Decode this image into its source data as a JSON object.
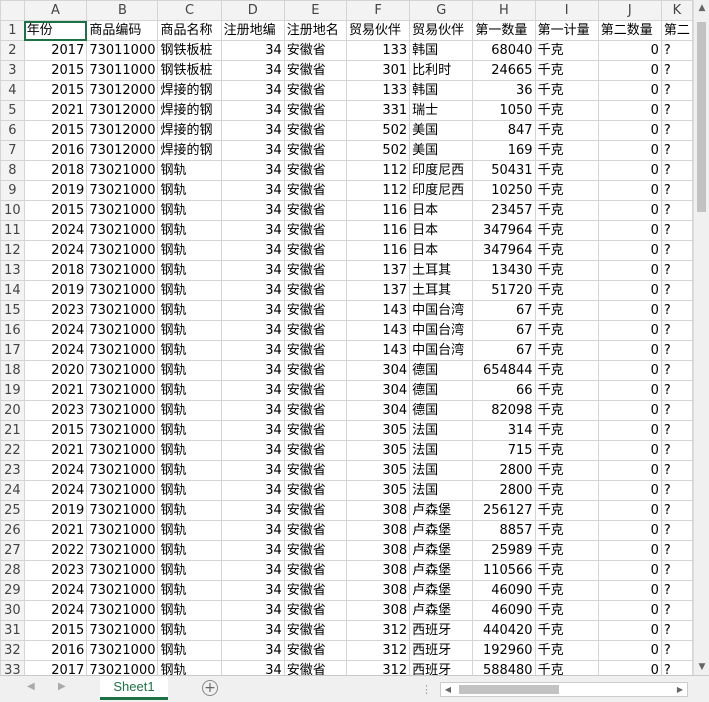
{
  "columns": [
    "A",
    "B",
    "C",
    "D",
    "E",
    "F",
    "G",
    "H",
    "I",
    "J",
    "K"
  ],
  "header_row": [
    "年份",
    "商品编码",
    "商品名称",
    "注册地编",
    "注册地名",
    "贸易伙伴",
    "贸易伙伴",
    "第一数量",
    "第一计量",
    "第二数量",
    "第二"
  ],
  "rows": [
    [
      "2",
      "2017",
      "73011000",
      "钢铁板桩",
      "34",
      "安徽省",
      "133",
      "韩国",
      "68040",
      "千克",
      "0",
      "?"
    ],
    [
      "3",
      "2015",
      "73011000",
      "钢铁板桩",
      "34",
      "安徽省",
      "301",
      "比利时",
      "24665",
      "千克",
      "0",
      "?"
    ],
    [
      "4",
      "2015",
      "73012000",
      "焊接的钢",
      "34",
      "安徽省",
      "133",
      "韩国",
      "36",
      "千克",
      "0",
      "?"
    ],
    [
      "5",
      "2021",
      "73012000",
      "焊接的钢",
      "34",
      "安徽省",
      "331",
      "瑞士",
      "1050",
      "千克",
      "0",
      "?"
    ],
    [
      "6",
      "2015",
      "73012000",
      "焊接的钢",
      "34",
      "安徽省",
      "502",
      "美国",
      "847",
      "千克",
      "0",
      "?"
    ],
    [
      "7",
      "2016",
      "73012000",
      "焊接的钢",
      "34",
      "安徽省",
      "502",
      "美国",
      "169",
      "千克",
      "0",
      "?"
    ],
    [
      "8",
      "2018",
      "73021000",
      "钢轨",
      "34",
      "安徽省",
      "112",
      "印度尼西",
      "50431",
      "千克",
      "0",
      "?"
    ],
    [
      "9",
      "2019",
      "73021000",
      "钢轨",
      "34",
      "安徽省",
      "112",
      "印度尼西",
      "10250",
      "千克",
      "0",
      "?"
    ],
    [
      "10",
      "2015",
      "73021000",
      "钢轨",
      "34",
      "安徽省",
      "116",
      "日本",
      "23457",
      "千克",
      "0",
      "?"
    ],
    [
      "11",
      "2024",
      "73021000",
      "钢轨",
      "34",
      "安徽省",
      "116",
      "日本",
      "347964",
      "千克",
      "0",
      "?"
    ],
    [
      "12",
      "2024",
      "73021000",
      "钢轨",
      "34",
      "安徽省",
      "116",
      "日本",
      "347964",
      "千克",
      "0",
      "?"
    ],
    [
      "13",
      "2018",
      "73021000",
      "钢轨",
      "34",
      "安徽省",
      "137",
      "土耳其",
      "13430",
      "千克",
      "0",
      "?"
    ],
    [
      "14",
      "2019",
      "73021000",
      "钢轨",
      "34",
      "安徽省",
      "137",
      "土耳其",
      "51720",
      "千克",
      "0",
      "?"
    ],
    [
      "15",
      "2023",
      "73021000",
      "钢轨",
      "34",
      "安徽省",
      "143",
      "中国台湾",
      "67",
      "千克",
      "0",
      "?"
    ],
    [
      "16",
      "2024",
      "73021000",
      "钢轨",
      "34",
      "安徽省",
      "143",
      "中国台湾",
      "67",
      "千克",
      "0",
      "?"
    ],
    [
      "17",
      "2024",
      "73021000",
      "钢轨",
      "34",
      "安徽省",
      "143",
      "中国台湾",
      "67",
      "千克",
      "0",
      "?"
    ],
    [
      "18",
      "2020",
      "73021000",
      "钢轨",
      "34",
      "安徽省",
      "304",
      "德国",
      "654844",
      "千克",
      "0",
      "?"
    ],
    [
      "19",
      "2021",
      "73021000",
      "钢轨",
      "34",
      "安徽省",
      "304",
      "德国",
      "66",
      "千克",
      "0",
      "?"
    ],
    [
      "20",
      "2023",
      "73021000",
      "钢轨",
      "34",
      "安徽省",
      "304",
      "德国",
      "82098",
      "千克",
      "0",
      "?"
    ],
    [
      "21",
      "2015",
      "73021000",
      "钢轨",
      "34",
      "安徽省",
      "305",
      "法国",
      "314",
      "千克",
      "0",
      "?"
    ],
    [
      "22",
      "2021",
      "73021000",
      "钢轨",
      "34",
      "安徽省",
      "305",
      "法国",
      "715",
      "千克",
      "0",
      "?"
    ],
    [
      "23",
      "2024",
      "73021000",
      "钢轨",
      "34",
      "安徽省",
      "305",
      "法国",
      "2800",
      "千克",
      "0",
      "?"
    ],
    [
      "24",
      "2024",
      "73021000",
      "钢轨",
      "34",
      "安徽省",
      "305",
      "法国",
      "2800",
      "千克",
      "0",
      "?"
    ],
    [
      "25",
      "2019",
      "73021000",
      "钢轨",
      "34",
      "安徽省",
      "308",
      "卢森堡",
      "256127",
      "千克",
      "0",
      "?"
    ],
    [
      "26",
      "2021",
      "73021000",
      "钢轨",
      "34",
      "安徽省",
      "308",
      "卢森堡",
      "8857",
      "千克",
      "0",
      "?"
    ],
    [
      "27",
      "2022",
      "73021000",
      "钢轨",
      "34",
      "安徽省",
      "308",
      "卢森堡",
      "25989",
      "千克",
      "0",
      "?"
    ],
    [
      "28",
      "2023",
      "73021000",
      "钢轨",
      "34",
      "安徽省",
      "308",
      "卢森堡",
      "110566",
      "千克",
      "0",
      "?"
    ],
    [
      "29",
      "2024",
      "73021000",
      "钢轨",
      "34",
      "安徽省",
      "308",
      "卢森堡",
      "46090",
      "千克",
      "0",
      "?"
    ],
    [
      "30",
      "2024",
      "73021000",
      "钢轨",
      "34",
      "安徽省",
      "308",
      "卢森堡",
      "46090",
      "千克",
      "0",
      "?"
    ],
    [
      "31",
      "2015",
      "73021000",
      "钢轨",
      "34",
      "安徽省",
      "312",
      "西班牙",
      "440420",
      "千克",
      "0",
      "?"
    ],
    [
      "32",
      "2016",
      "73021000",
      "钢轨",
      "34",
      "安徽省",
      "312",
      "西班牙",
      "192960",
      "千克",
      "0",
      "?"
    ],
    [
      "33",
      "2017",
      "73021000",
      "钢轨",
      "34",
      "安徽省",
      "312",
      "西班牙",
      "588480",
      "千克",
      "0",
      "?"
    ]
  ],
  "sheet_tab": "Sheet1",
  "add_sheet_icon": "plus-circle-icon",
  "accent_color": "#1e7145"
}
